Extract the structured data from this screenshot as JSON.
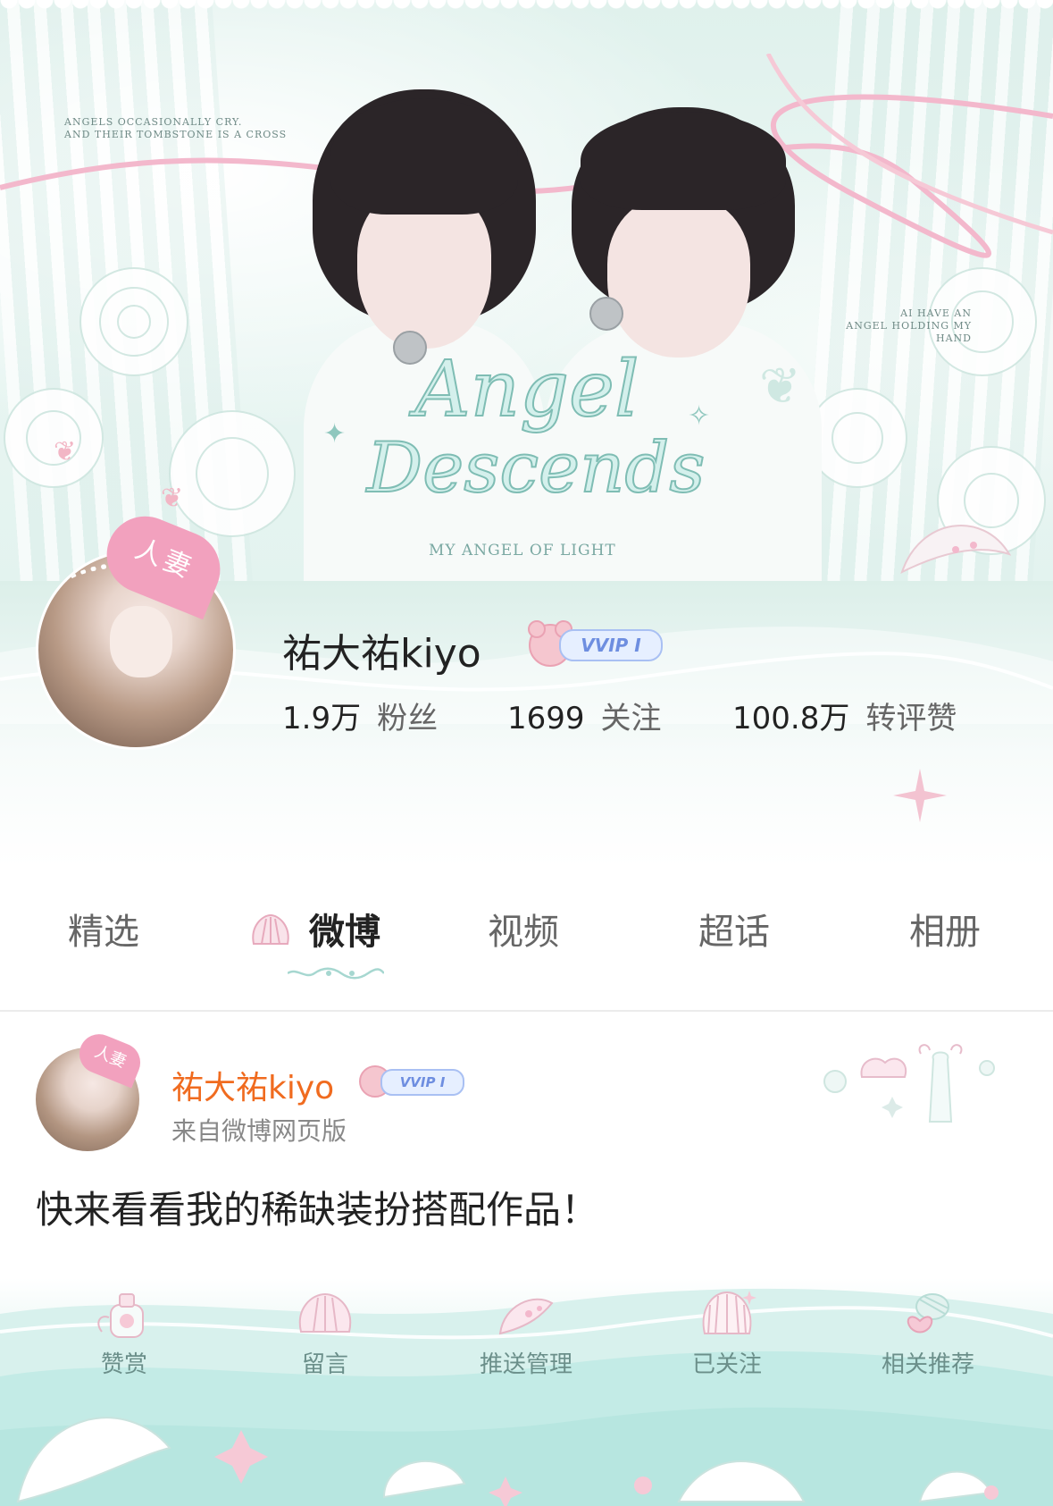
{
  "banner": {
    "quote_left": [
      "ANGELS OCCASIONALLY CRY.",
      "AND THEIR TOMBSTONE IS A CROSS"
    ],
    "quote_right": [
      "AI HAVE AN",
      "ANGEL HOLDING MY HAND"
    ],
    "title_line1": "Angel",
    "title_line2": "Descends",
    "subtitle": "MY ANGEL OF LIGHT"
  },
  "profile": {
    "username": "祐大祐kiyo",
    "avatar_badge": "人妻",
    "vip_label": "VVIP I",
    "stats": [
      {
        "value": "1.9万",
        "label": "粉丝"
      },
      {
        "value": "1699",
        "label": "关注"
      },
      {
        "value": "100.8万",
        "label": "转评赞"
      }
    ]
  },
  "tabs": [
    {
      "label": "精选",
      "active": false
    },
    {
      "label": "微博",
      "active": true
    },
    {
      "label": "视频",
      "active": false
    },
    {
      "label": "超话",
      "active": false
    },
    {
      "label": "相册",
      "active": false
    }
  ],
  "post": {
    "username": "祐大祐kiyo",
    "avatar_badge": "人妻",
    "vip_label": "VVIP I",
    "source": "来自微博网页版",
    "content": "快来看看我的稀缺装扮搭配作品！"
  },
  "actions": [
    {
      "label": "赞赏",
      "icon": "perfume-bottle-icon"
    },
    {
      "label": "留言",
      "icon": "shell-icon"
    },
    {
      "label": "推送管理",
      "icon": "conch-icon"
    },
    {
      "label": "已关注",
      "icon": "scallop-icon"
    },
    {
      "label": "相关推荐",
      "icon": "candy-icon"
    }
  ],
  "colors": {
    "accent_username": "#f06b1f",
    "theme_mint": "#cfeee9",
    "badge_pink": "#f2a1be",
    "vip_blue": "#6e8ee0"
  }
}
